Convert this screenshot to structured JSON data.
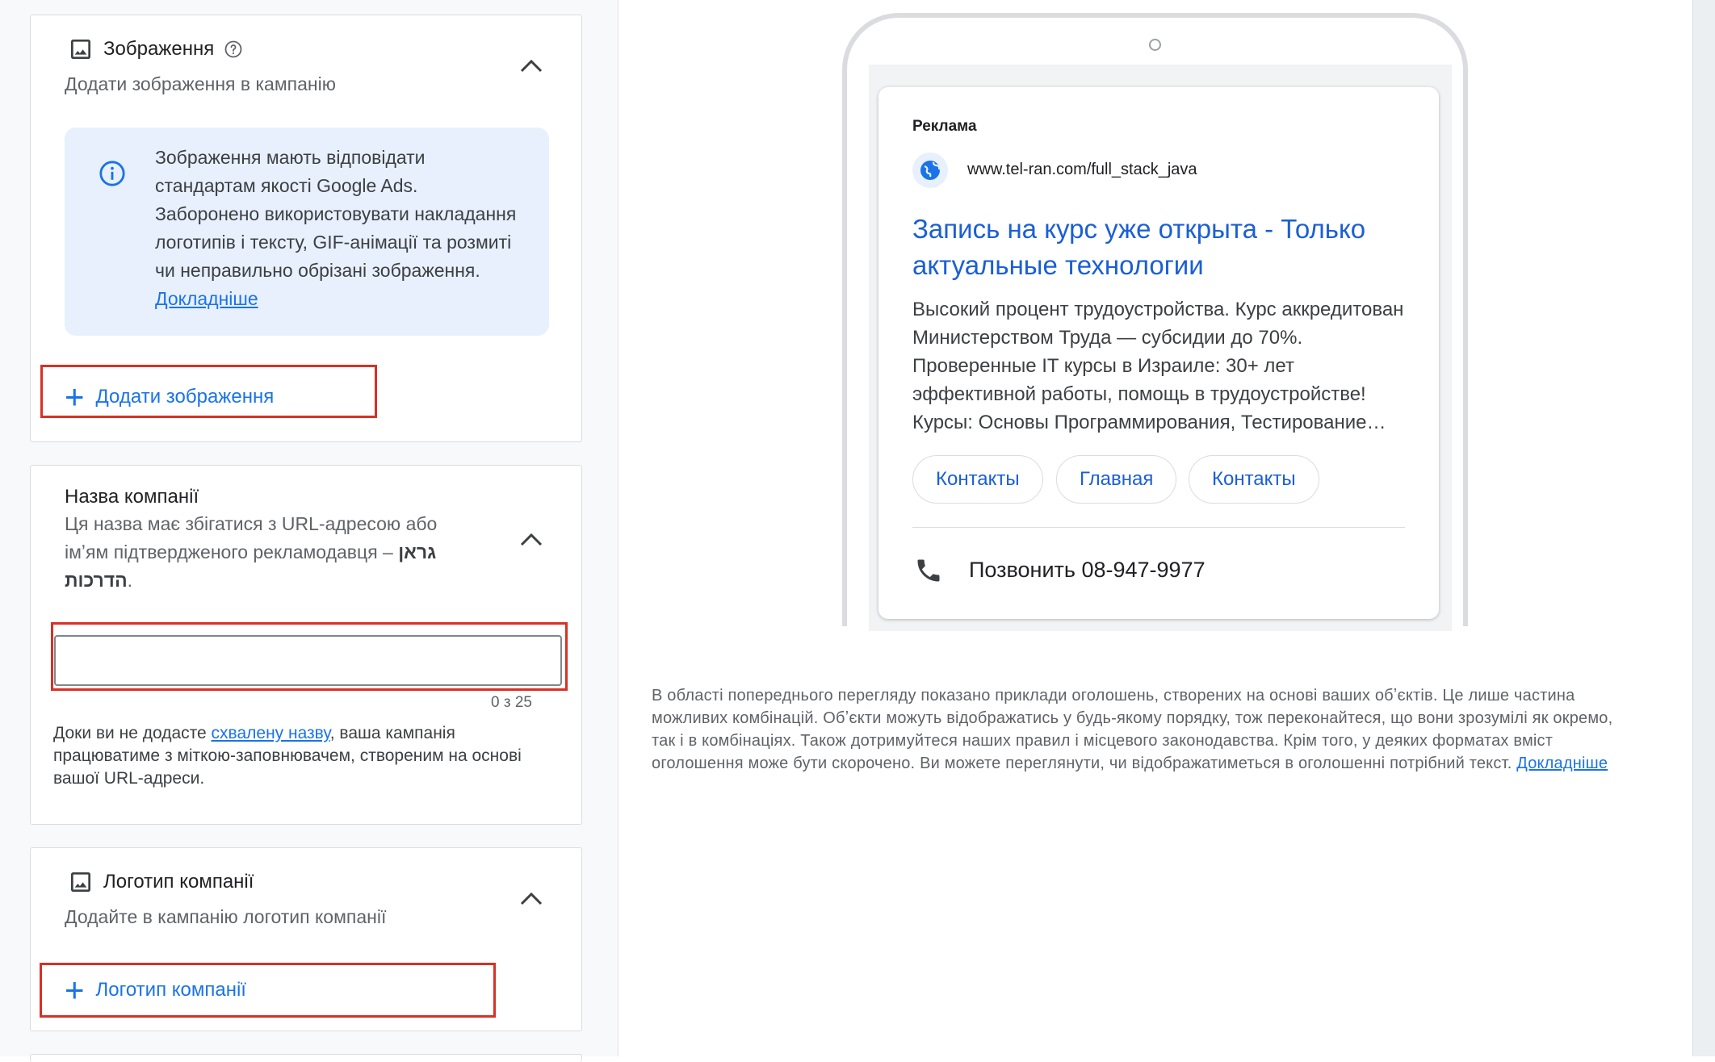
{
  "images_card": {
    "title": "Зображення",
    "subtitle": "Додати зображення в кампанію",
    "info_text": "Зображення мають відповідати стандартам якості Google Ads. Заборонено використовувати накладання логотипів і тексту, GIF-анімації та розмиті чи неправильно обрізані зображення.",
    "info_link": "Докладніше",
    "add_button": "Додати зображення"
  },
  "name_card": {
    "title": "Назва компанії",
    "subtitle_prefix": "Ця назва має збігатися з URL-адресою або імʼям підтвердженого рекламодавця –",
    "advertiser": "גראן הדרכות",
    "subtitle_suffix": ".",
    "input_value": "",
    "counter": "0 з 25",
    "note_prefix": "Доки ви не додасте",
    "note_link": "схвалену назву",
    "note_suffix": ", ваша кампанія працюватиме з міткою-заповнювачем, створеним на основі вашої URL-адреси."
  },
  "logo_card": {
    "title": "Логотип компанії",
    "subtitle": "Додайте в кампанію логотип компанії",
    "add_button": "Логотип компанії"
  },
  "ad_preview": {
    "label": "Реклама",
    "url": "www.tel-ran.com/full_stack_java",
    "headline": "Запись на курс уже открыта - Только актуальные технологии",
    "description": "Высокий процент трудоустройства. Курс аккредитован Министерством Труда — субсидии до 70%. Проверенные IT курсы в Израиле: 30+ лет эффективной работы, помощь в трудоустройстве!",
    "description_last": "Курсы: Основы Программирования, Тестирование…",
    "sitelinks": [
      "Контакты",
      "Главная",
      "Контакты"
    ],
    "call": "Позвонить 08-947-9977"
  },
  "preview_note": {
    "text": "В області попереднього перегляду показано приклади оголошень, створених на основі ваших обʼєктів. Це лише частина можливих комбінацій. Обʼєкти можуть відображатись у будь-якому порядку, тож переконайтеся, що вони зрозумілі як окремо, так і в комбінаціях. Також дотримуйтеся наших правил і місцевого законодавства. Крім того, у деяких форматах вміст оголошення може бути скорочено. Ви можете переглянути, чи відображатиметься в оголошенні потрібний текст.",
    "link": "Докладніше"
  },
  "colors": {
    "accent": "#1a73e8",
    "highlight": "#d93025",
    "info_bg": "#e8f0fe"
  },
  "icons": [
    "image-icon",
    "help-icon",
    "chevron-up-icon",
    "info-icon",
    "plus-icon",
    "globe-icon",
    "phone-icon"
  ]
}
